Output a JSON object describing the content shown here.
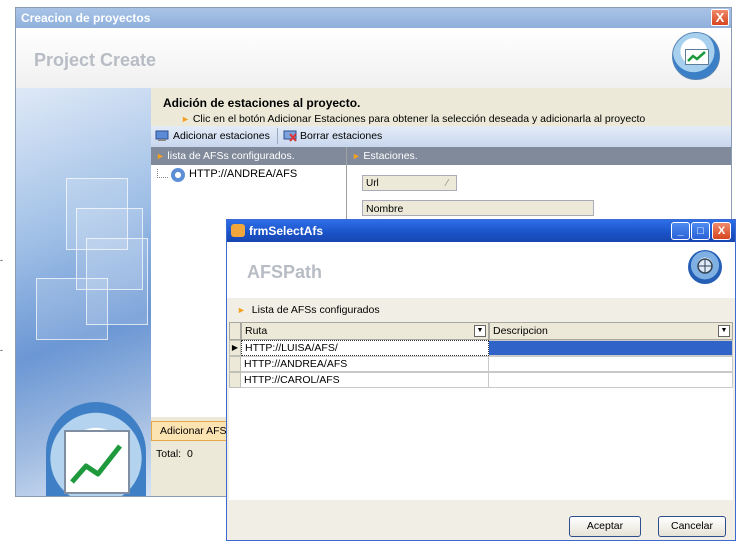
{
  "main_window": {
    "title": "Creacion de proyectos",
    "close_label": "X",
    "header_title": "Project Create",
    "description_title": "Adición de estaciones al proyecto.",
    "description_text": "Clic en el botón Adicionar Estaciones para obtener la selección deseada y adicionarla al proyecto",
    "toolbar": {
      "add_label": "Adicionar estaciones",
      "delete_label": "Borrar estaciones"
    },
    "left_panel": {
      "header": "lista de AFSs configurados.",
      "items": [
        "HTTP://ANDREA/AFS"
      ]
    },
    "right_panel": {
      "header": "Estaciones.",
      "group_field": "Url",
      "column_name": "Nombre"
    },
    "bottom_button": "Adicionar AFS",
    "total_label": "Total:",
    "total_value": "0"
  },
  "popup": {
    "title": "frmSelectAfs",
    "header_title": "AFSPath",
    "section_label": "Lista de AFSs configurados",
    "columns": [
      "Ruta",
      "Descripcion"
    ],
    "rows": [
      {
        "ruta": "HTTP://LUISA/AFS/",
        "descripcion": ""
      },
      {
        "ruta": "HTTP://ANDREA/AFS",
        "descripcion": ""
      },
      {
        "ruta": "HTTP://CAROL/AFS",
        "descripcion": ""
      }
    ],
    "ok_label": "Aceptar",
    "cancel_label": "Cancelar"
  }
}
